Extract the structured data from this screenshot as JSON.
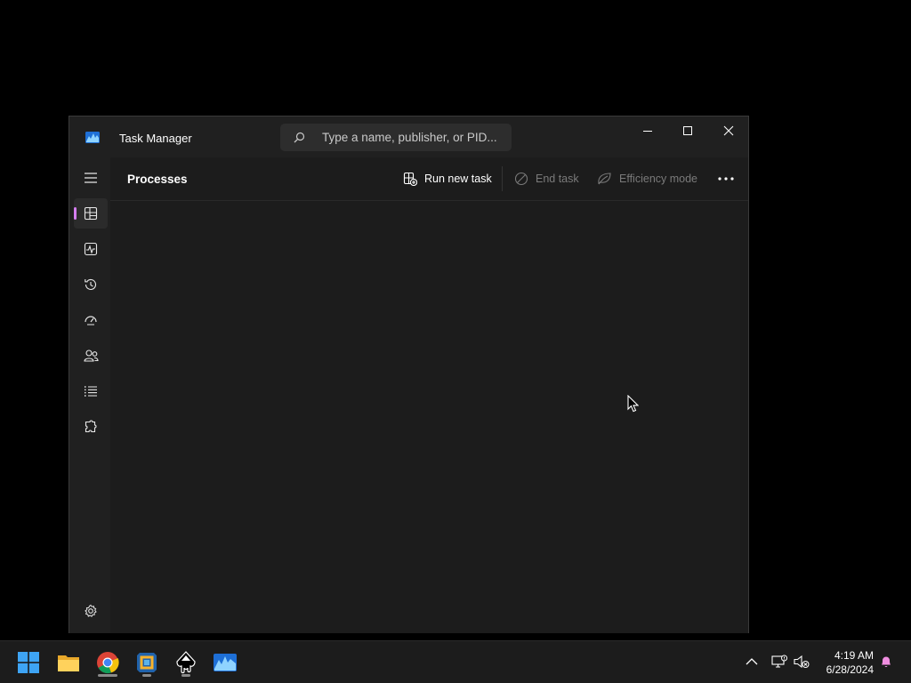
{
  "window": {
    "title": "Task Manager",
    "search_placeholder": "Type a name, publisher, or PID..."
  },
  "nav": {
    "items": [
      {
        "name": "Processes",
        "icon": "processes-icon",
        "active": true
      },
      {
        "name": "Performance",
        "icon": "performance-icon"
      },
      {
        "name": "App history",
        "icon": "app-history-icon"
      },
      {
        "name": "Startup apps",
        "icon": "startup-apps-icon"
      },
      {
        "name": "Users",
        "icon": "users-icon"
      },
      {
        "name": "Details",
        "icon": "details-icon"
      },
      {
        "name": "Services",
        "icon": "services-icon"
      }
    ],
    "accent": "#d57ef0"
  },
  "content": {
    "title": "Processes",
    "commands": {
      "run_new_task": "Run new task",
      "end_task": "End task",
      "efficiency_mode": "Efficiency mode"
    }
  },
  "taskbar": {
    "apps": [
      "start-button",
      "file-explorer",
      "chrome",
      "virtualbox",
      "inkscape",
      "task-manager"
    ],
    "time": "4:19 AM",
    "date": "6/28/2024"
  }
}
